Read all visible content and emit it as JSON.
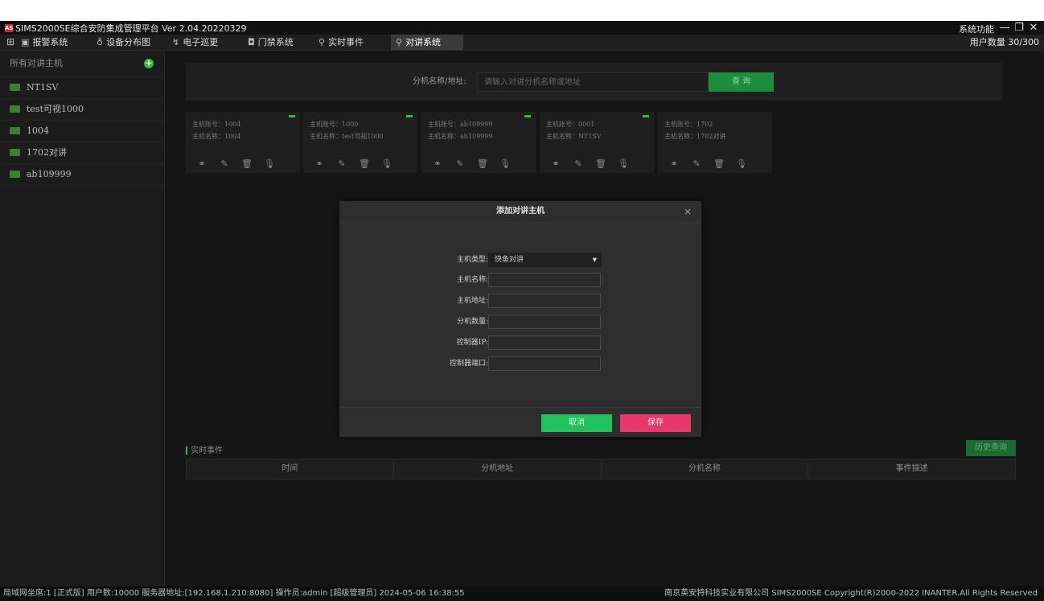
{
  "titlebar": {
    "logo_text": "AS",
    "title": "SIMS2000SE综合安防集成管理平台 Ver 2.04.20220329",
    "system_menu": "系统功能",
    "controls": [
      "—",
      "❐",
      "✕"
    ]
  },
  "menubar": {
    "items": [
      {
        "icon": "▣",
        "label": "报警系统"
      },
      {
        "icon": "♁",
        "label": "设备分布图"
      },
      {
        "icon": "↯",
        "label": "电子巡更"
      },
      {
        "icon": "◘",
        "label": "门禁系统"
      },
      {
        "icon": "⚲",
        "label": "实时事件"
      },
      {
        "icon": "⚲",
        "label": "对讲系统"
      }
    ],
    "user_count": "用户数量 30/300"
  },
  "sidebar": {
    "header": "所有对讲主机",
    "items": [
      "NT1SV",
      "test可视1000",
      "1004",
      "1702对讲",
      "ab109999"
    ]
  },
  "search": {
    "label": "分机名称/地址:",
    "placeholder": "请输入对讲分机名称或地址",
    "button": "查 询"
  },
  "cards": [
    {
      "line1": "主机账号：1004",
      "line2": "主机名称：1004",
      "online": true
    },
    {
      "line1": "主机账号：1000",
      "line2": "主机名称：test可视1000",
      "online": true
    },
    {
      "line1": "主机账号：ab109999",
      "line2": "主机名称：ab109999",
      "online": true
    },
    {
      "line1": "主机账号：0001",
      "line2": "主机名称：NT1SV",
      "online": true
    },
    {
      "line1": "主机账号：1702",
      "line2": "主机名称：1702对讲",
      "online": false
    }
  ],
  "events": {
    "title": "实时事件",
    "history_button": "历史查询",
    "columns": [
      "时间",
      "分机地址",
      "分机名称",
      "事件描述"
    ]
  },
  "statusbar": {
    "left": "局域网坐席:1 [正式版] 用户数:10000 服务器地址:[192.168.1.210:8080]  操作员:admin [超级管理员]   2024-05-06 16:38:55",
    "right": "南京英安特科技实业有限公司  SIMS2000SE Copyright(R)2000-2022 INANTER.All Rights Reserved"
  },
  "modal": {
    "title": "添加对讲主机",
    "close": "×",
    "type_label": "主机类型:",
    "type_value": "快鱼对讲",
    "name_label": "主机名称:",
    "name_value": "",
    "address_label": "主机地址:",
    "address_value": "",
    "count_label": "分机数量:",
    "count_value": "",
    "ip_label": "控制器IP:",
    "ip_value": "",
    "port_label": "控制器端口:",
    "port_value": "",
    "cancel": "取消",
    "save": "保存"
  },
  "colors": {
    "background": "#151515",
    "accent_green": "#22c15b",
    "save_pink": "#e6386a",
    "status_online": "#2fbe3c"
  }
}
